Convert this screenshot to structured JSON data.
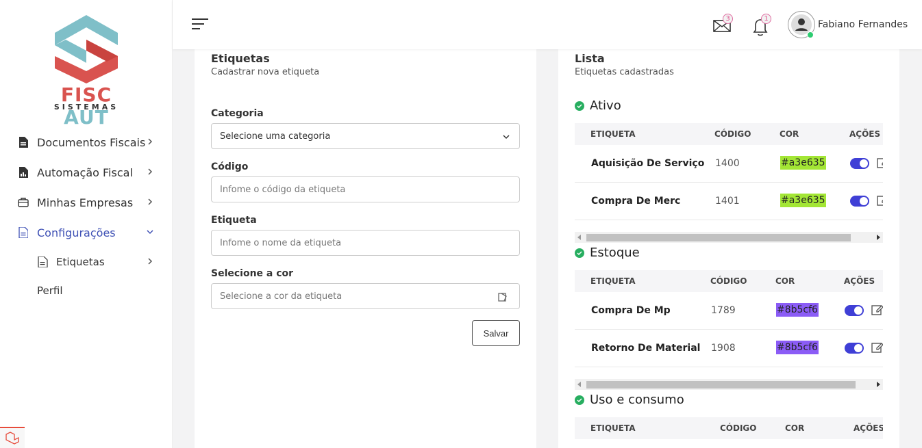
{
  "brand": {
    "name_part1": "FISC",
    "name_part2": "AUT",
    "tagline": "SISTEMAS",
    "logo_colors": {
      "teal": "#7fbfc8",
      "red": "#d9534f"
    }
  },
  "sidebar": {
    "items": [
      {
        "label": "Documentos Fiscais",
        "icon": "file-icon"
      },
      {
        "label": "Automação Fiscal",
        "icon": "file-chart-icon"
      },
      {
        "label": "Minhas Empresas",
        "icon": "briefcase-icon"
      },
      {
        "label": "Configurações",
        "icon": "file-settings-icon",
        "active": true
      }
    ],
    "sub_items": [
      {
        "label": "Etiquetas",
        "icon": "document-icon"
      },
      {
        "label": "Perfil"
      }
    ]
  },
  "header": {
    "mail_count": "3",
    "notification_count": "1",
    "user_name": "Fabiano Fernandes"
  },
  "form": {
    "title": "Etiquetas",
    "subtitle": "Cadastrar nova etiqueta",
    "category_label": "Categoria",
    "category_value": "Selecione uma categoria",
    "code_label": "Código",
    "code_placeholder": "Infome o código da etiqueta",
    "tag_label": "Etiqueta",
    "tag_placeholder": "Infome o nome da etiqueta",
    "color_label": "Selecione a cor",
    "color_placeholder": "Selecione a cor da etiqueta",
    "save_label": "Salvar"
  },
  "list": {
    "title": "Lista",
    "subtitle": "Etiquetas cadastradas",
    "columns": {
      "tag": "ETIQUETA",
      "code": "CÓDIGO",
      "color": "COR",
      "actions": "AÇÕES"
    },
    "groups": [
      {
        "name": "Ativo",
        "rows": [
          {
            "tag": "Aquisição De Serviço",
            "code": "1400",
            "color": "#a3e635",
            "active": true
          },
          {
            "tag": "Compra De Merc",
            "code": "1401",
            "color": "#a3e635",
            "active": true
          }
        ]
      },
      {
        "name": "Estoque",
        "rows": [
          {
            "tag": "Compra De Mp",
            "code": "1789",
            "color": "#8b5cf6",
            "active": true
          },
          {
            "tag": "Retorno De Material",
            "code": "1908",
            "color": "#8b5cf6",
            "active": true
          }
        ]
      },
      {
        "name": "Uso e consumo",
        "rows": []
      }
    ]
  }
}
